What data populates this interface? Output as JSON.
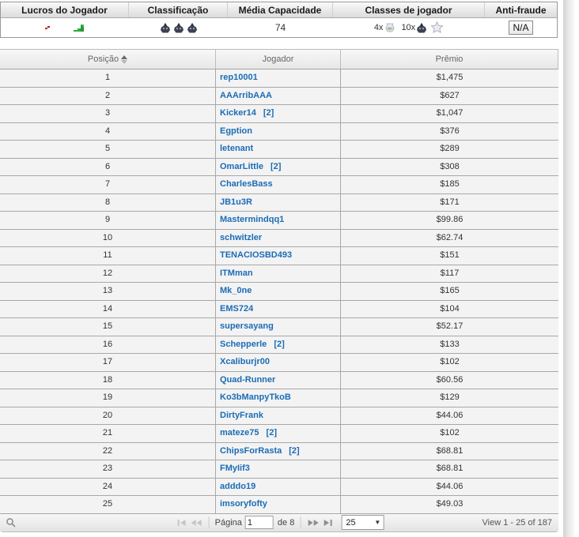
{
  "stats": {
    "columns": [
      "Lucros do Jogador",
      "Classificação",
      "Média Capacidade",
      "Classes de jogador",
      "Anti-fraude"
    ],
    "media_capacidade": "74",
    "classes": {
      "bowl_multiplier": "4x",
      "shark_multiplier": "10x"
    },
    "anti_fraude": "N/A"
  },
  "icons": {
    "loss_sparkline": "loss-sparkline-icon",
    "profit_sparkline": "profit-sparkline-icon",
    "shark": "shark-icon",
    "fishbowl": "fishbowl-icon",
    "star": "star-icon",
    "search": "search-icon"
  },
  "table": {
    "headers": {
      "position": "Posição",
      "player": "Jogador",
      "prize": "Prêmio"
    },
    "rows": [
      {
        "pos": "1",
        "player": "rep10001",
        "tag": "",
        "prize": "$1,475"
      },
      {
        "pos": "2",
        "player": "AAArribAAA",
        "tag": "",
        "prize": "$627"
      },
      {
        "pos": "3",
        "player": "Kicker14",
        "tag": "[2]",
        "prize": "$1,047"
      },
      {
        "pos": "4",
        "player": "Egption",
        "tag": "",
        "prize": "$376"
      },
      {
        "pos": "5",
        "player": "letenant",
        "tag": "",
        "prize": "$289"
      },
      {
        "pos": "6",
        "player": "OmarLittle",
        "tag": "[2]",
        "prize": "$308"
      },
      {
        "pos": "7",
        "player": "CharlesBass",
        "tag": "",
        "prize": "$185"
      },
      {
        "pos": "8",
        "player": "JB1u3R",
        "tag": "",
        "prize": "$171"
      },
      {
        "pos": "9",
        "player": "Mastermindqq1",
        "tag": "",
        "prize": "$99.86"
      },
      {
        "pos": "10",
        "player": "schwitzler",
        "tag": "",
        "prize": "$62.74"
      },
      {
        "pos": "11",
        "player": "TENACIOSBD493",
        "tag": "",
        "prize": "$151"
      },
      {
        "pos": "12",
        "player": "ITMman",
        "tag": "",
        "prize": "$117"
      },
      {
        "pos": "13",
        "player": "Mk_0ne",
        "tag": "",
        "prize": "$165"
      },
      {
        "pos": "14",
        "player": "EMS724",
        "tag": "",
        "prize": "$104"
      },
      {
        "pos": "15",
        "player": "supersayang",
        "tag": "",
        "prize": "$52.17"
      },
      {
        "pos": "16",
        "player": "Schepperle",
        "tag": "[2]",
        "prize": "$133"
      },
      {
        "pos": "17",
        "player": "Xcaliburjr00",
        "tag": "",
        "prize": "$102"
      },
      {
        "pos": "18",
        "player": "Quad-Runner",
        "tag": "",
        "prize": "$60.56"
      },
      {
        "pos": "19",
        "player": "Ko3bManpyTkoB",
        "tag": "",
        "prize": "$129"
      },
      {
        "pos": "20",
        "player": "DirtyFrank",
        "tag": "",
        "prize": "$44.06"
      },
      {
        "pos": "21",
        "player": "mateze75",
        "tag": "[2]",
        "prize": "$102"
      },
      {
        "pos": "22",
        "player": "ChipsForRasta",
        "tag": "[2]",
        "prize": "$68.81"
      },
      {
        "pos": "23",
        "player": "FMyIif3",
        "tag": "",
        "prize": "$68.81"
      },
      {
        "pos": "24",
        "player": "adddo19",
        "tag": "",
        "prize": "$44.06"
      },
      {
        "pos": "25",
        "player": "imsoryfofty",
        "tag": "",
        "prize": "$49.03"
      }
    ]
  },
  "pager": {
    "page_label": "Página",
    "page_value": "1",
    "total_label": "de 8",
    "page_size": "25",
    "view_text": "View 1 - 25 of 187"
  },
  "colors": {
    "link_blue": "#1b6cb5",
    "row_bg": "#f3f3f3",
    "grid_border": "#a8a8a8",
    "profit_green": "#2fae3a",
    "loss_red": "#d81e1e"
  }
}
